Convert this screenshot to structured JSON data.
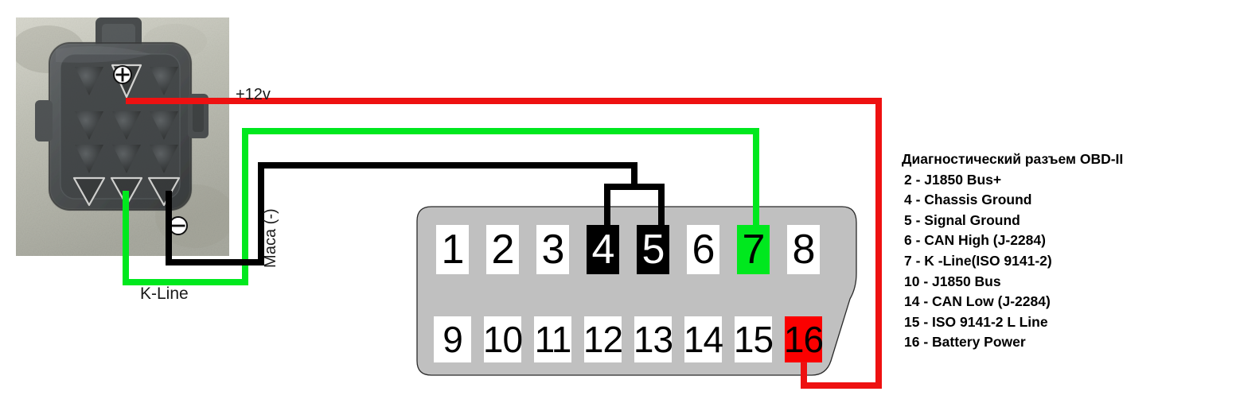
{
  "diagram": {
    "title_visible": false,
    "colors": {
      "wire_power": "#ee1111",
      "wire_kline": "#00e81e",
      "wire_ground": "#000000",
      "connector_body": "#c0c0c0",
      "pin_default_bg": "#ffffff",
      "pin_black_bg": "#000000",
      "pin_green_bg": "#00e81e",
      "pin_red_bg": "#fb0000"
    }
  },
  "photo": {
    "alt_name": "vehicle-diagnostic-socket-photo",
    "plus_symbol": "⊕",
    "minus_symbol": "⊖"
  },
  "labels": {
    "power": "+12v",
    "kline": "K-Line",
    "ground": "Маса (-)"
  },
  "obd_connector": {
    "name": "OBD-II 16-pin connector",
    "top_row": [
      {
        "number": "1",
        "state": "default"
      },
      {
        "number": "2",
        "state": "default"
      },
      {
        "number": "3",
        "state": "default"
      },
      {
        "number": "4",
        "state": "black"
      },
      {
        "number": "5",
        "state": "black"
      },
      {
        "number": "6",
        "state": "default"
      },
      {
        "number": "7",
        "state": "green"
      },
      {
        "number": "8",
        "state": "default"
      }
    ],
    "bottom_row": [
      {
        "number": "9",
        "state": "default"
      },
      {
        "number": "10",
        "state": "default"
      },
      {
        "number": "11",
        "state": "default"
      },
      {
        "number": "12",
        "state": "default"
      },
      {
        "number": "13",
        "state": "default"
      },
      {
        "number": "14",
        "state": "default"
      },
      {
        "number": "15",
        "state": "default"
      },
      {
        "number": "16",
        "state": "red"
      }
    ]
  },
  "legend": {
    "title": "Диагностический разъем OBD-II",
    "rows": [
      " 2 - J1850 Bus+",
      " 4 - Chassis Ground",
      " 5 - Signal Ground",
      " 6 - CAN High (J-2284)",
      " 7 -  K -Line(ISO 9141-2)",
      "10 - J1850 Bus",
      "14 - CAN Low (J-2284)",
      "15 - ISO 9141-2 L Line",
      "16 - Battery Power"
    ]
  },
  "wiring": {
    "connections": [
      {
        "from": "socket-top-middle-pin",
        "to": "obd-pin-16",
        "color": "#ee1111",
        "label": "+12v"
      },
      {
        "from": "socket-bottom-middle-pin",
        "to": "obd-pin-7",
        "color": "#00e81e",
        "label": "K-Line"
      },
      {
        "from": "socket-bottom-right-pin",
        "to": "obd-pin-4",
        "color": "#000000",
        "label": "Маса (-)"
      },
      {
        "from": "socket-bottom-right-pin",
        "to": "obd-pin-5",
        "color": "#000000",
        "label": "Маса (-)"
      }
    ]
  }
}
